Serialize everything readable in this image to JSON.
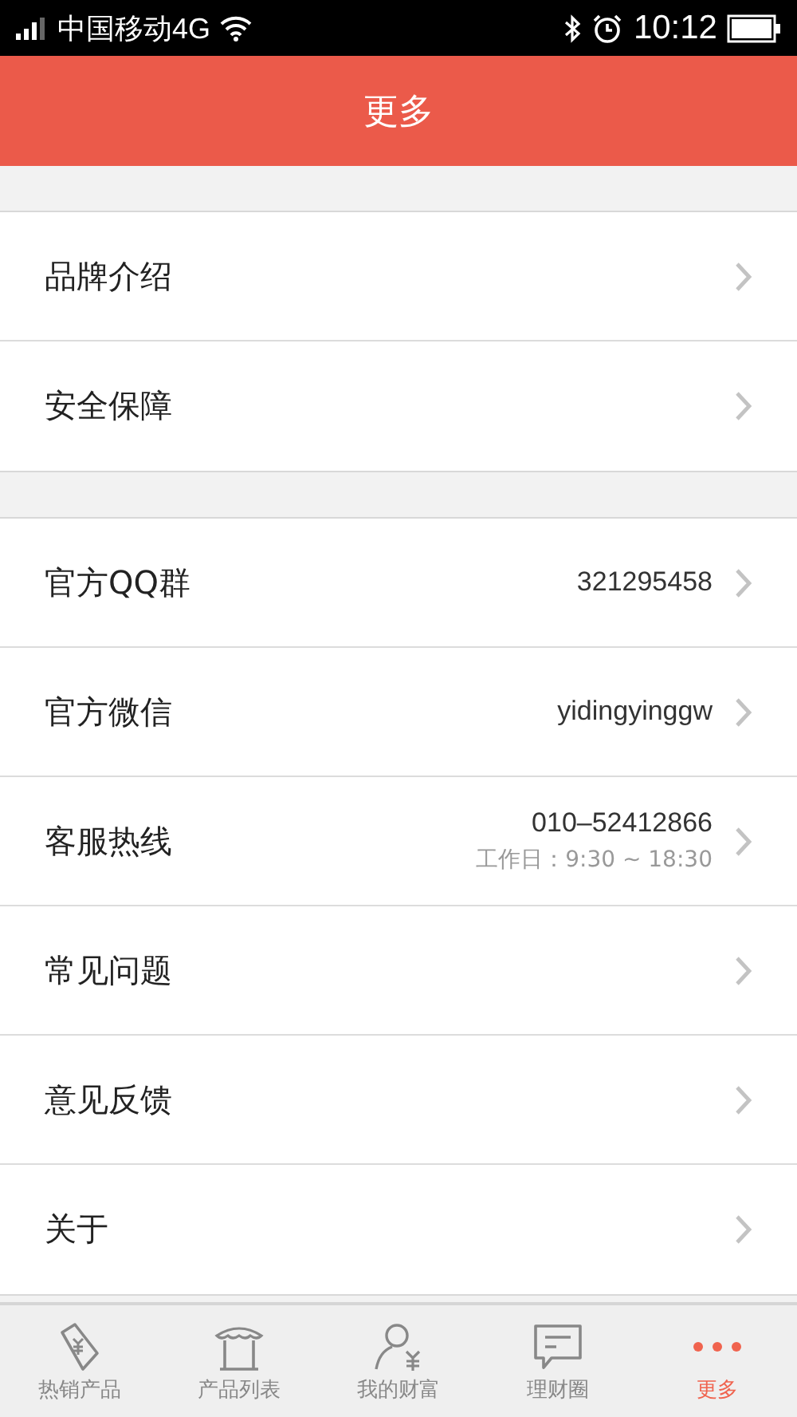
{
  "status_bar": {
    "carrier": "中国移动4G",
    "time": "10:12"
  },
  "header": {
    "title": "更多"
  },
  "groups": [
    {
      "rows": [
        {
          "label": "品牌介绍"
        },
        {
          "label": "安全保障"
        }
      ]
    },
    {
      "rows": [
        {
          "label": "官方QQ群",
          "value": "321295458"
        },
        {
          "label": "官方微信",
          "value": "yidingyinggw"
        },
        {
          "label": "客服热线",
          "value": "010–52412866",
          "note": "工作日：9:30 ~ 18:30"
        },
        {
          "label": "常见问题"
        },
        {
          "label": "意见反馈"
        },
        {
          "label": "关于"
        }
      ]
    }
  ],
  "tabs": [
    {
      "kind": "tag",
      "label": "热销产品",
      "selected": false
    },
    {
      "kind": "store",
      "label": "产品列表",
      "selected": false
    },
    {
      "kind": "person",
      "label": "我的财富",
      "selected": false
    },
    {
      "kind": "chat",
      "label": "理财圈",
      "selected": false
    },
    {
      "kind": "more",
      "label": "更多",
      "selected": true
    }
  ]
}
